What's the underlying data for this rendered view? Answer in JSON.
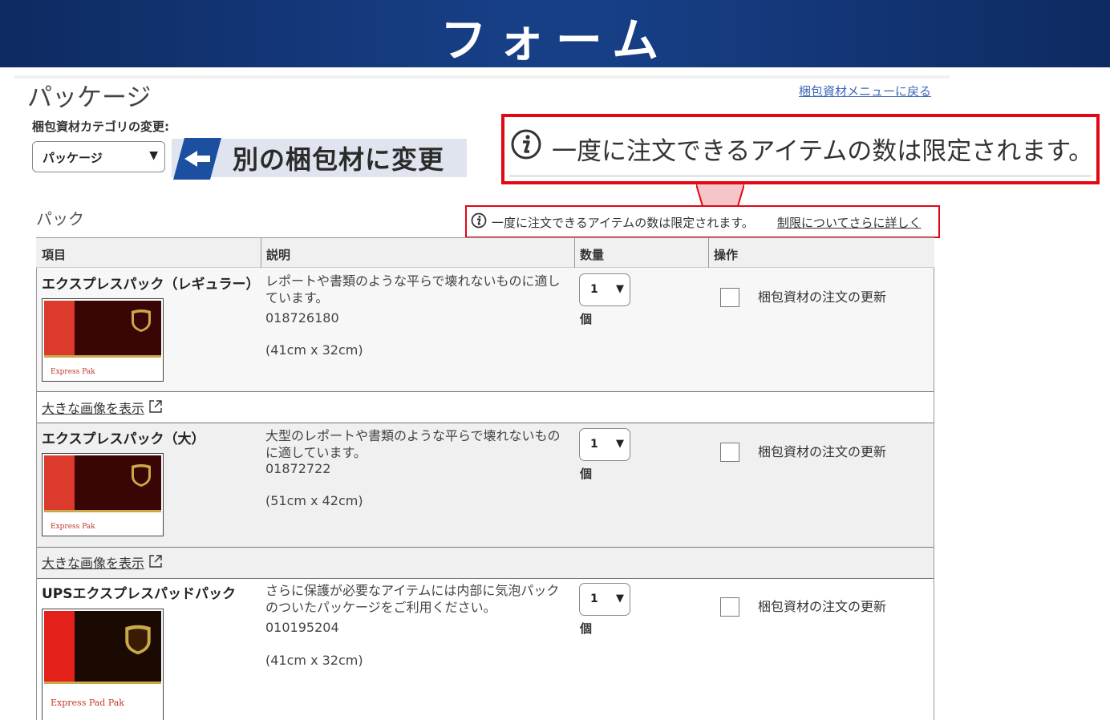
{
  "banner": {
    "title": "フォーム"
  },
  "page": {
    "title": "パッケージ",
    "back_link": "梱包資材メニューに戻る",
    "category_label": "梱包資材カテゴリの変更:",
    "category_value": "パッケージ",
    "change_callout": "別の梱包材に変更",
    "big_notice": "一度に注文できるアイテムの数は限定されます。",
    "section_label": "パック",
    "small_notice": "一度に注文できるアイテムの数は限定されます。",
    "small_notice_link": "制限についてさらに詳しく"
  },
  "table": {
    "headers": [
      "項目",
      "説明",
      "数量",
      "操作"
    ],
    "view_larger": "大きな画像を表示",
    "rows": [
      {
        "name": "エクスプレスパック（レギュラー）",
        "thumb_label": "Express Pak",
        "desc": "レポートや書類のような平らで壊れないものに適しています。",
        "code": "018726180",
        "size": "(41cm x 32cm)",
        "qty": "1",
        "unit": "個",
        "action": "梱包資材の注文の更新"
      },
      {
        "name": "エクスプレスパック（大）",
        "thumb_label": "Express Pak",
        "desc": "大型のレポートや書類のような平らで壊れないものに適しています。",
        "code": "01872722",
        "size": "(51cm x 42cm)",
        "qty": "1",
        "unit": "個",
        "action": "梱包資材の注文の更新"
      },
      {
        "name": "UPSエクスプレスパッドパック",
        "thumb_label": "Express Pad Pak",
        "desc": "さらに保護が必要なアイテムには内部に気泡パックのついたパッケージをご利用ください。",
        "code": "010195204",
        "size": "(41cm x 32cm)",
        "qty": "1",
        "unit": "個",
        "action": "梱包資材の注文の更新"
      }
    ]
  },
  "colors": {
    "banner": "#173f86",
    "notice_red": "#e30613",
    "link_blue": "#3a66b8"
  }
}
